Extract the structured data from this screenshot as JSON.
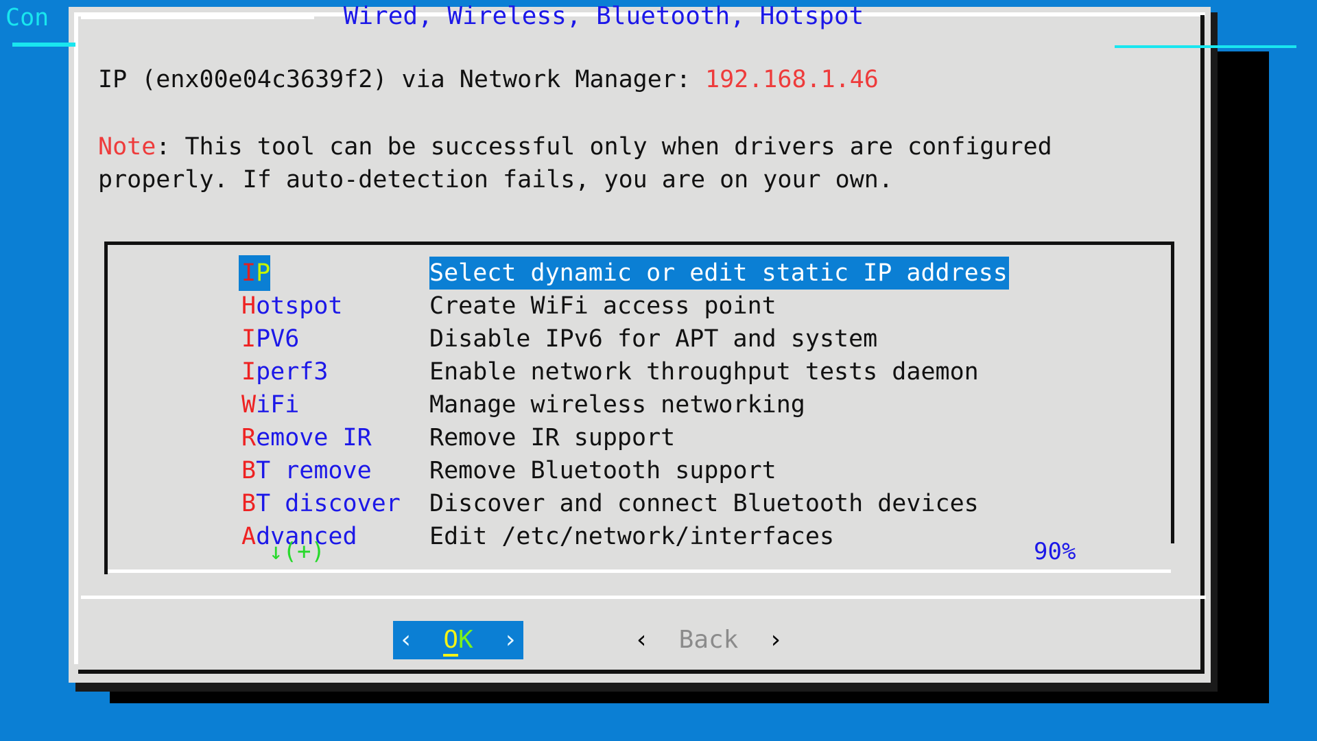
{
  "desktop": {
    "topbar_title": "Con",
    "background_color": "#0b7fd4",
    "terminal_color": "#000000",
    "accent_color": "#19e6ef"
  },
  "dialog": {
    "title": "Wired, Wireless, Bluetooth, Hotspot",
    "title_color": "#1c18e8",
    "background_color": "#dededd",
    "ip_line": {
      "prefix": "IP (enx00e04c3639f2) via Network Manager: ",
      "value": "192.168.1.46",
      "value_color": "#ee3b3b"
    },
    "note": {
      "label": "Note",
      "label_color": "#ee3b3b",
      "text": ": This tool can be successful only when drivers are configured properly. If auto-detection fails, you are on your own."
    }
  },
  "menu": {
    "selected_index": 0,
    "highlight_color": "#0b7fd4",
    "hotkey_color": "#ee2222",
    "tag_color": "#1c18e8",
    "items": [
      {
        "hotkey": "I",
        "tag_rest": "P",
        "desc": "Select dynamic or edit static IP address"
      },
      {
        "hotkey": "H",
        "tag_rest": "otspot",
        "desc": "Create WiFi access point"
      },
      {
        "hotkey": "I",
        "tag_rest": "PV6",
        "desc": "Disable IPv6 for APT and system"
      },
      {
        "hotkey": "I",
        "tag_rest": "perf3",
        "desc": "Enable network throughput tests daemon"
      },
      {
        "hotkey": "W",
        "tag_rest": "iFi",
        "desc": "Manage wireless networking"
      },
      {
        "hotkey": "R",
        "tag_rest": "emove IR",
        "desc": "Remove IR support"
      },
      {
        "hotkey": "B",
        "tag_rest": "T remove",
        "desc": "Remove Bluetooth support"
      },
      {
        "hotkey": "B",
        "tag_rest": "T discover",
        "desc": "Discover and connect Bluetooth devices"
      },
      {
        "hotkey": "A",
        "tag_rest": "dvanced",
        "desc": "Edit /etc/network/interfaces"
      }
    ],
    "scroll_indicator": "↓(+)",
    "scroll_indicator_color": "#27d92b",
    "scroll_percent": "90%",
    "scroll_percent_color": "#1c18e8"
  },
  "buttons": {
    "ok": {
      "left_chevron": "‹",
      "right_chevron": "›",
      "label_hot": "O",
      "label_rest": "K",
      "focused": true
    },
    "back": {
      "left_chevron": "‹",
      "right_chevron": "›",
      "label": "Back",
      "focused": false
    }
  }
}
